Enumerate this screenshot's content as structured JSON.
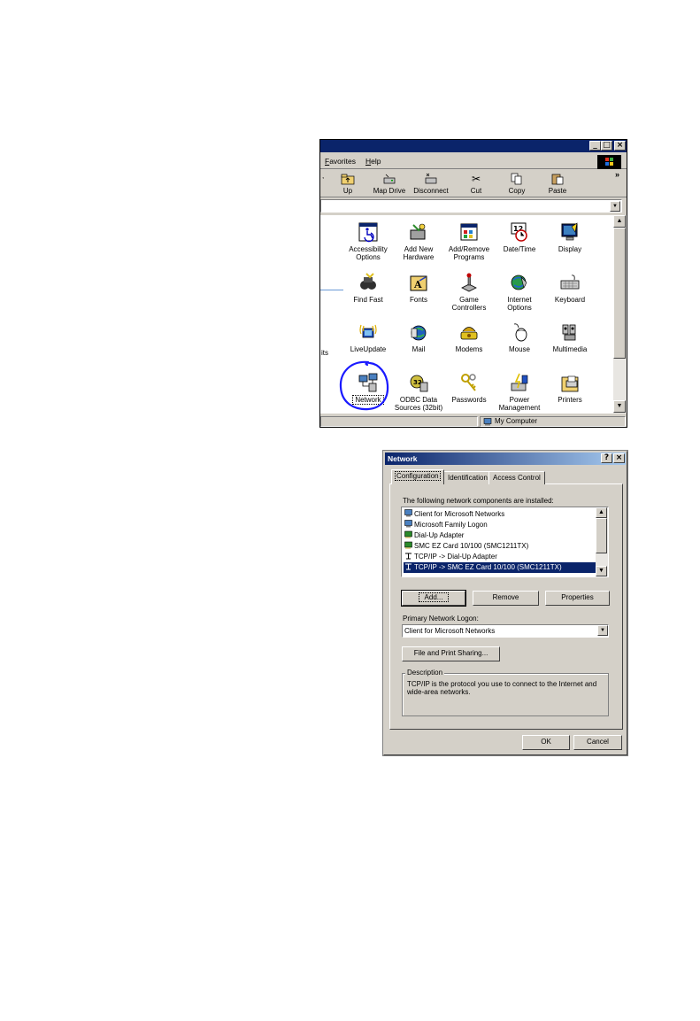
{
  "control_panel": {
    "menu": [
      "Favorites",
      "Help"
    ],
    "toolbar": [
      {
        "label": "Up",
        "icon": "up-folder-icon"
      },
      {
        "label": "Map Drive",
        "icon": "map-drive-icon"
      },
      {
        "label": "Disconnect",
        "icon": "disconnect-icon"
      },
      {
        "label": "Cut",
        "icon": "cut-icon"
      },
      {
        "label": "Copy",
        "icon": "copy-icon"
      },
      {
        "label": "Paste",
        "icon": "paste-icon"
      }
    ],
    "chevron": "»",
    "side_partial_text": "its",
    "icons": [
      {
        "label": "Accessibility\nOptions",
        "icon": "accessibility-icon"
      },
      {
        "label": "Add New\nHardware",
        "icon": "add-hardware-icon"
      },
      {
        "label": "Add/Remove\nPrograms",
        "icon": "add-remove-programs-icon"
      },
      {
        "label": "Date/Time",
        "icon": "date-time-icon"
      },
      {
        "label": "Display",
        "icon": "display-icon"
      },
      {
        "label": "Find Fast",
        "icon": "find-fast-icon"
      },
      {
        "label": "Fonts",
        "icon": "fonts-icon"
      },
      {
        "label": "Game\nControllers",
        "icon": "game-controllers-icon"
      },
      {
        "label": "Internet\nOptions",
        "icon": "internet-options-icon"
      },
      {
        "label": "Keyboard",
        "icon": "keyboard-icon"
      },
      {
        "label": "LiveUpdate",
        "icon": "liveupdate-icon"
      },
      {
        "label": "Mail",
        "icon": "mail-icon"
      },
      {
        "label": "Modems",
        "icon": "modems-icon"
      },
      {
        "label": "Mouse",
        "icon": "mouse-icon"
      },
      {
        "label": "Multimedia",
        "icon": "multimedia-icon"
      },
      {
        "label": "Network",
        "icon": "network-icon"
      },
      {
        "label": "ODBC Data\nSources (32bit)",
        "icon": "odbc-icon"
      },
      {
        "label": "Passwords",
        "icon": "passwords-icon"
      },
      {
        "label": "Power\nManagement",
        "icon": "power-management-icon"
      },
      {
        "label": "Printers",
        "icon": "printers-icon"
      }
    ],
    "status_text": "My Computer",
    "highlight_color": "#1a1aff"
  },
  "network": {
    "title": "Network",
    "help_label": "?",
    "close_label": "×",
    "tabs": [
      "Configuration",
      "Identification",
      "Access Control"
    ],
    "components_label": "The following network components are installed:",
    "components": [
      {
        "text": "Client for Microsoft Networks",
        "icon": "client-icon"
      },
      {
        "text": "Microsoft Family Logon",
        "icon": "client-icon"
      },
      {
        "text": "Dial-Up Adapter",
        "icon": "adapter-icon"
      },
      {
        "text": "SMC EZ Card 10/100 (SMC1211TX)",
        "icon": "adapter-icon"
      },
      {
        "text": "TCP/IP -> Dial-Up Adapter",
        "icon": "protocol-icon"
      },
      {
        "text": "TCP/IP -> SMC EZ Card 10/100 (SMC1211TX)",
        "icon": "protocol-icon"
      }
    ],
    "buttons": {
      "add": "Add...",
      "remove": "Remove",
      "properties": "Properties"
    },
    "primary_logon_label": "Primary Network Logon:",
    "primary_logon_value": "Client for Microsoft Networks",
    "file_print_sharing": "File and Print Sharing...",
    "description_label": "Description",
    "description_text": "TCP/IP is the protocol you use to connect to the Internet and wide-area networks.",
    "ok": "OK",
    "cancel": "Cancel",
    "selected_color": "#0a246a"
  }
}
